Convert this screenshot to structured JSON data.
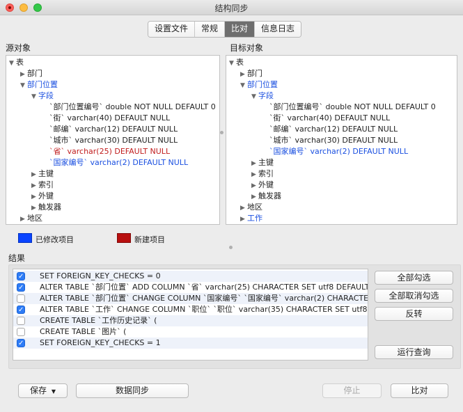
{
  "window": {
    "title": "结构同步"
  },
  "tabs": [
    {
      "label": "设置文件",
      "active": false
    },
    {
      "label": "常规",
      "active": false
    },
    {
      "label": "比对",
      "active": true
    },
    {
      "label": "信息日志",
      "active": false
    }
  ],
  "source": {
    "label": "源对象",
    "tree": [
      {
        "text": "表",
        "state": "expanded",
        "level": 0,
        "color": "normal"
      },
      {
        "text": "部门",
        "state": "collapsed",
        "level": 1,
        "color": "normal"
      },
      {
        "text": "部门位置",
        "state": "expanded",
        "level": 1,
        "color": "blue"
      },
      {
        "text": "字段",
        "state": "expanded",
        "level": 2,
        "color": "blue"
      },
      {
        "text": "`部门位置编号` double NOT NULL DEFAULT 0",
        "state": "leaf",
        "level": 3,
        "color": "normal"
      },
      {
        "text": "`街` varchar(40) DEFAULT NULL",
        "state": "leaf",
        "level": 3,
        "color": "normal"
      },
      {
        "text": "`邮编` varchar(12) DEFAULT NULL",
        "state": "leaf",
        "level": 3,
        "color": "normal"
      },
      {
        "text": "`城市` varchar(30) DEFAULT NULL",
        "state": "leaf",
        "level": 3,
        "color": "normal"
      },
      {
        "text": "`省` varchar(25) DEFAULT NULL",
        "state": "leaf",
        "level": 3,
        "color": "red"
      },
      {
        "text": "`国家编号` varchar(2) DEFAULT NULL",
        "state": "leaf",
        "level": 3,
        "color": "blue"
      },
      {
        "text": "主键",
        "state": "collapsed",
        "level": 2,
        "color": "normal"
      },
      {
        "text": "索引",
        "state": "collapsed",
        "level": 2,
        "color": "normal"
      },
      {
        "text": "外键",
        "state": "collapsed",
        "level": 2,
        "color": "normal"
      },
      {
        "text": "触发器",
        "state": "collapsed",
        "level": 2,
        "color": "normal"
      },
      {
        "text": "地区",
        "state": "collapsed",
        "level": 1,
        "color": "normal"
      }
    ]
  },
  "target": {
    "label": "目标对象",
    "tree": [
      {
        "text": "表",
        "state": "expanded",
        "level": 0,
        "color": "normal"
      },
      {
        "text": "部门",
        "state": "collapsed",
        "level": 1,
        "color": "normal"
      },
      {
        "text": "部门位置",
        "state": "expanded",
        "level": 1,
        "color": "blue"
      },
      {
        "text": "字段",
        "state": "expanded",
        "level": 2,
        "color": "blue"
      },
      {
        "text": "`部门位置编号` double NOT NULL DEFAULT 0",
        "state": "leaf",
        "level": 3,
        "color": "normal"
      },
      {
        "text": "`街` varchar(40) DEFAULT NULL",
        "state": "leaf",
        "level": 3,
        "color": "normal"
      },
      {
        "text": "`邮编` varchar(12) DEFAULT NULL",
        "state": "leaf",
        "level": 3,
        "color": "normal"
      },
      {
        "text": "`城市` varchar(30) DEFAULT NULL",
        "state": "leaf",
        "level": 3,
        "color": "normal"
      },
      {
        "text": "`国家编号` varchar(2) DEFAULT NULL",
        "state": "leaf",
        "level": 3,
        "color": "blue"
      },
      {
        "text": "主键",
        "state": "collapsed",
        "level": 2,
        "color": "normal"
      },
      {
        "text": "索引",
        "state": "collapsed",
        "level": 2,
        "color": "normal"
      },
      {
        "text": "外键",
        "state": "collapsed",
        "level": 2,
        "color": "normal"
      },
      {
        "text": "触发器",
        "state": "collapsed",
        "level": 2,
        "color": "normal"
      },
      {
        "text": "地区",
        "state": "collapsed",
        "level": 1,
        "color": "normal"
      },
      {
        "text": "工作",
        "state": "collapsed",
        "level": 1,
        "color": "blue"
      }
    ]
  },
  "legend": {
    "modified": {
      "label": "已修改项目",
      "color": "#0a44ff"
    },
    "new": {
      "label": "新建项目",
      "color": "#b80f0f"
    }
  },
  "results": {
    "label": "结果",
    "rows": [
      {
        "checked": true,
        "text": "SET FOREIGN_KEY_CHECKS = 0"
      },
      {
        "checked": true,
        "text": "ALTER TABLE `部门位置` ADD COLUMN `省` varchar(25) CHARACTER SET utf8 DEFAULT"
      },
      {
        "checked": false,
        "text": "ALTER TABLE `部门位置` CHANGE COLUMN `国家编号` `国家编号` varchar(2) CHARACTER"
      },
      {
        "checked": true,
        "text": "ALTER TABLE `工作` CHANGE COLUMN `职位` `职位` varchar(35) CHARACTER SET utf8 D"
      },
      {
        "checked": false,
        "text": "CREATE TABLE `工作历史记录` ("
      },
      {
        "checked": false,
        "text": "CREATE TABLE `图片` ("
      },
      {
        "checked": true,
        "text": "SET FOREIGN_KEY_CHECKS = 1"
      }
    ],
    "buttons": {
      "select_all": "全部勾选",
      "deselect_all": "全部取消勾选",
      "invert": "反转",
      "run_query": "运行查询"
    }
  },
  "footer": {
    "save": "保存",
    "sync": "数据同步",
    "stop": "停止",
    "compare": "比对"
  },
  "colors": {
    "modified": "#1a4fe0",
    "new": "#c01c1c",
    "accent": "#2e7cf6"
  }
}
